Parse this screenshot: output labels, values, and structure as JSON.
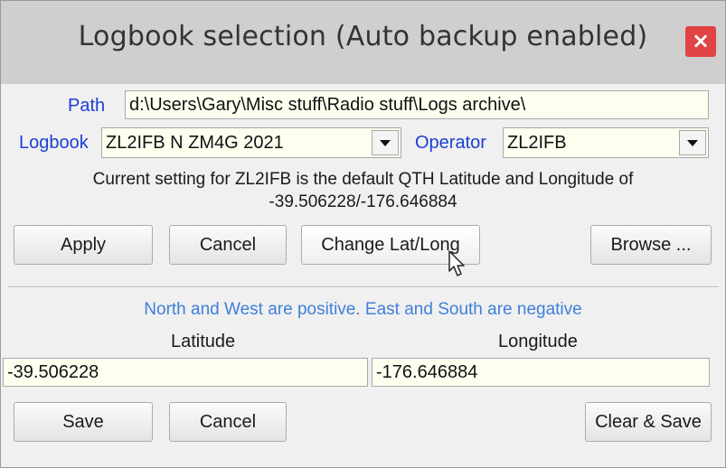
{
  "window": {
    "title": "Logbook selection (Auto backup enabled)",
    "close_glyph": "×"
  },
  "path": {
    "label": "Path",
    "value": "d:\\Users\\Gary\\Misc stuff\\Radio stuff\\Logs archive\\"
  },
  "logbook": {
    "label": "Logbook",
    "selected": "ZL2IFB N ZM4G 2021"
  },
  "operator": {
    "label": "Operator",
    "selected": "ZL2IFB"
  },
  "info": {
    "line1": "Current setting for ZL2IFB is the default QTH Latitude and Longitude of",
    "line2": "-39.506228/-176.646884"
  },
  "buttons_top": {
    "apply": "Apply",
    "cancel": "Cancel",
    "change_lat_long": "Change Lat/Long",
    "browse": "Browse ..."
  },
  "coords": {
    "note": "North and West are positive. East and South are negative",
    "latitude_label": "Latitude",
    "longitude_label": "Longitude",
    "latitude_value": "-39.506228",
    "longitude_value": "-176.646884"
  },
  "buttons_bottom": {
    "save": "Save",
    "cancel": "Cancel",
    "clear_save": "Clear & Save"
  },
  "colors": {
    "field_bg": "#fffff0",
    "label_blue": "#1b3fd6",
    "note_blue": "#3f7fd9",
    "close_red": "#e04343",
    "titlebar": "#cfcfcf"
  }
}
